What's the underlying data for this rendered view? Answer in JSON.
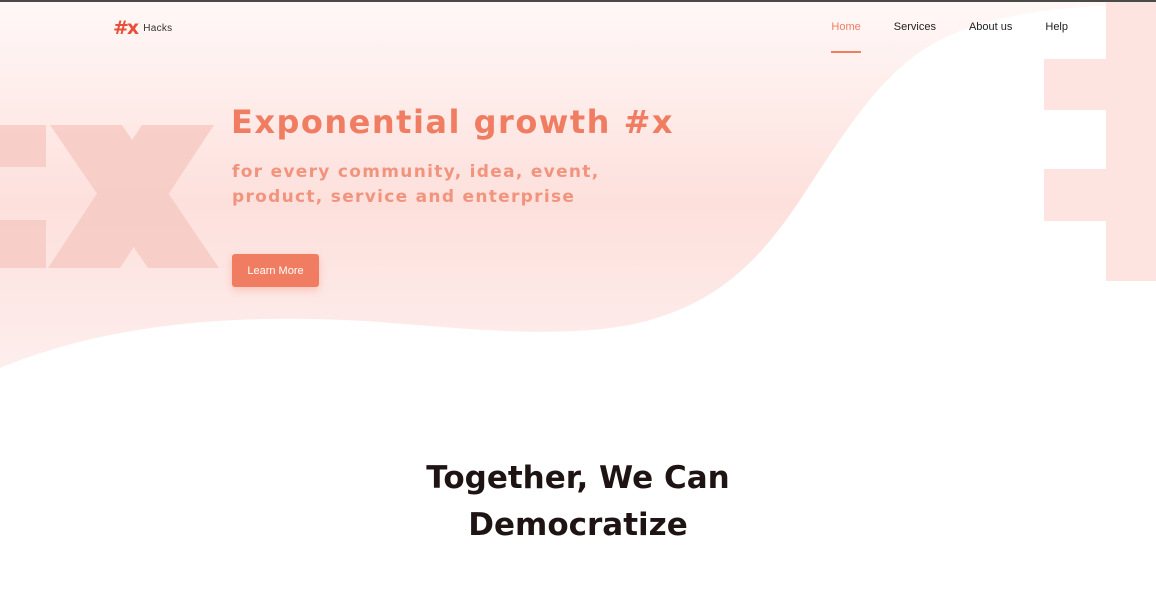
{
  "brand": {
    "logo_mark": "#x",
    "name": "Hacks",
    "accent": "#f07d61",
    "logo_color": "#e8503a"
  },
  "nav": {
    "items": [
      {
        "label": "Home",
        "active": true
      },
      {
        "label": "Services",
        "active": false
      },
      {
        "label": "About us",
        "active": false
      },
      {
        "label": "Help",
        "active": false
      }
    ]
  },
  "hero": {
    "title": "Exponential growth #x",
    "subtitle": "for every community, idea, event, product, service and enterprise",
    "cta_label": "Learn More"
  },
  "section": {
    "title_line1": "Together, We Can",
    "title_line2": "Democratize"
  }
}
